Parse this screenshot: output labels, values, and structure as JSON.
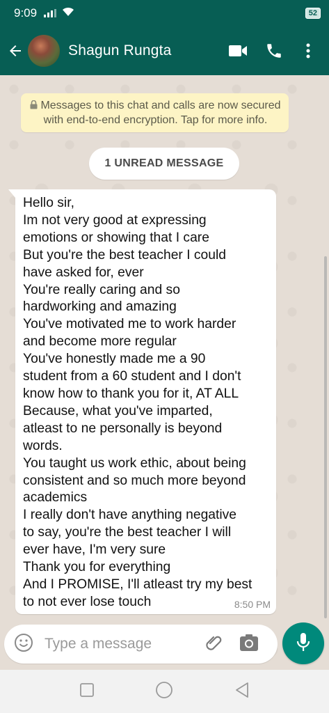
{
  "status_bar": {
    "time": "9:09",
    "battery": "52"
  },
  "header": {
    "contact_name": "Shagun Rungta",
    "icons": [
      "back-arrow-icon",
      "video-call-icon",
      "voice-call-icon",
      "more-options-icon"
    ]
  },
  "chat": {
    "encryption_notice": "Messages to this chat and calls are now secured with end-to-end encryption. Tap for more info.",
    "unread_label": "1 UNREAD MESSAGE",
    "message": {
      "lines": [
        "Hello sir,",
        "Im not very good at expressing",
        "emotions or showing that I care",
        "But you're the best teacher I could",
        "have asked for, ever",
        "You're really caring and so",
        "hardworking and amazing",
        "You've motivated me to work harder",
        "and become more regular",
        "You've honestly made me a 90",
        "student from a 60 student and I don't",
        "know how to thank you for it, AT ALL",
        "Because, what you've imparted,",
        "atleast to ne personally is beyond",
        "words.",
        "You taught us work ethic, about being",
        "consistent and so much more beyond",
        "academics",
        "I really don't have anything negative",
        "to say, you're the best teacher I will",
        "ever have, I'm very sure",
        "Thank you for everything",
        "And I PROMISE, I'll atleast try my best",
        "to not ever lose touch"
      ],
      "time": "8:50 PM"
    }
  },
  "composer": {
    "placeholder": "Type a message"
  },
  "colors": {
    "primary": "#075e54",
    "accent": "#00897b",
    "chat_bg": "#e5ddd5",
    "notice_bg": "#fdf4c5"
  }
}
